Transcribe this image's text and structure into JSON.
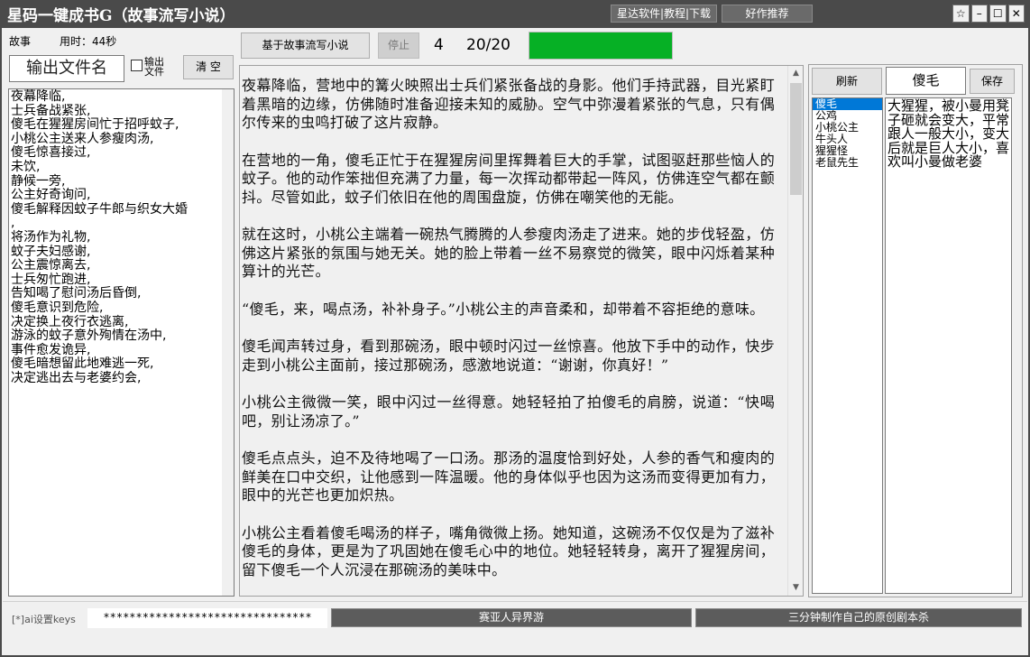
{
  "titlebar": {
    "title": "星码一键成书G（故事流写小说）",
    "link_buttons_label": "星达软件|教程|下载",
    "recommend_label": "好作推荐",
    "pin_glyph": "☆",
    "minimize_glyph": "–",
    "maximize_glyph": "☐",
    "close_glyph": "✕"
  },
  "top_left": {
    "mode_label": "故事",
    "time_label": "用时：44秒",
    "filename_placeholder": "输出文件名",
    "checkbox_label": "输出文件",
    "clear_label": "清 空"
  },
  "toolbar": {
    "generate_label": "基于故事流写小说",
    "stop_label": "停止",
    "count": "4",
    "progress_text": "20/20",
    "progress_fraction": 1.0,
    "progress_color": "#06b025"
  },
  "outline_lines": [
    "夜幕降临,",
    "士兵备战紧张,",
    "傻毛在猩猩房间忙于招呼蚊子,",
    "小桃公主送来人参瘦肉汤,",
    "傻毛惊喜接过,",
    "未饮,",
    "静候一旁,",
    "公主好奇询问,",
    "傻毛解释因蚊子牛郎与织女大婚",
    ",",
    "将汤作为礼物,",
    "蚊子夫妇感谢,",
    "公主震惊离去,",
    "士兵匆忙跑进,",
    "告知喝了慰问汤后昏倒,",
    "傻毛意识到危险,",
    "决定换上夜行衣逃离,",
    "游泳的蚊子意外殉情在汤中,",
    "事件愈发诡异,",
    "傻毛暗想留此地难逃一死,",
    "决定逃出去与老婆约会,"
  ],
  "story_paragraphs": [
    "夜幕降临，营地中的篝火映照出士兵们紧张备战的身影。他们手持武器，目光紧盯着黑暗的边缘，仿佛随时准备迎接未知的威胁。空气中弥漫着紧张的气息，只有偶尔传来的虫鸣打破了这片寂静。",
    "在营地的一角，傻毛正忙于在猩猩房间里挥舞着巨大的手掌，试图驱赶那些恼人的蚊子。他的动作笨拙但充满了力量，每一次挥动都带起一阵风，仿佛连空气都在颤抖。尽管如此，蚊子们依旧在他的周围盘旋，仿佛在嘲笑他的无能。",
    "就在这时，小桃公主端着一碗热气腾腾的人参瘦肉汤走了进来。她的步伐轻盈，仿佛这片紧张的氛围与她无关。她的脸上带着一丝不易察觉的微笑，眼中闪烁着某种算计的光芒。",
    "“傻毛，来，喝点汤，补补身子。”小桃公主的声音柔和，却带着不容拒绝的意味。",
    "傻毛闻声转过身，看到那碗汤，眼中顿时闪过一丝惊喜。他放下手中的动作，快步走到小桃公主面前，接过那碗汤，感激地说道：“谢谢，你真好！”",
    "小桃公主微微一笑，眼中闪过一丝得意。她轻轻拍了拍傻毛的肩膀，说道：“快喝吧，别让汤凉了。”",
    "傻毛点点头，迫不及待地喝了一口汤。那汤的温度恰到好处，人参的香气和瘦肉的鲜美在口中交织，让他感到一阵温暖。他的身体似乎也因为这汤而变得更加有力，眼中的光芒也更加炽热。",
    "小桃公主看着傻毛喝汤的样子，嘴角微微上扬。她知道，这碗汤不仅仅是为了滋补傻毛的身体，更是为了巩固她在傻毛心中的地位。她轻轻转身，离开了猩猩房间，留下傻毛一个人沉浸在那碗汤的美味中。"
  ],
  "right_panel": {
    "refresh_label": "刷新",
    "character_name": "傻毛",
    "save_label": "保存",
    "characters": [
      "傻毛",
      "公鸡",
      "小桃公主",
      "牛头人",
      "猩猩怪",
      "老鼠先生"
    ],
    "selected_index": 0,
    "character_desc": "大猩猩，被小曼用凳子砸就会变大，平常跟人一般大小，变大后就是巨人大小，喜欢叫小曼做老婆"
  },
  "bottom": {
    "keys_label": "[*]ai设置keys",
    "keys_value": "********************************",
    "promo1_label": "赛亚人异界游",
    "promo2_label": "三分钟制作自己的原创剧本杀"
  },
  "colors": {
    "titlebar_bg": "#4a4a4a",
    "selection": "#0078d7"
  }
}
